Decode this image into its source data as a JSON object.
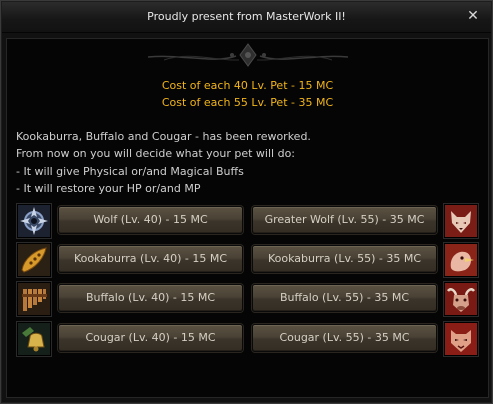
{
  "window": {
    "title": "Proudly present from MasterWork II!",
    "close_label": "✕"
  },
  "costs": {
    "line1": "Cost of each 40 Lv. Pet - 15 MC",
    "line2": "Cost of each 55 Lv. Pet - 35 MC"
  },
  "description": [
    "Kookaburra, Buffalo and Cougar - has been reworked.",
    "From now on you will decide what your pet will do:",
    "- It will give Physical or/and Magical Buffs",
    "- It will restore your HP or/and MP"
  ],
  "pets": [
    {
      "left_icon": "wolf-collar-icon",
      "right_icon": "greater-wolf-portrait-icon",
      "lv40_label": "Wolf (Lv. 40) - 15 MC",
      "lv55_label": "Greater Wolf (Lv. 55) - 35 MC"
    },
    {
      "left_icon": "ocarina-icon",
      "right_icon": "kookaburra-portrait-icon",
      "lv40_label": "Kookaburra (Lv. 40) - 15 MC",
      "lv55_label": "Kookaburra (Lv. 55) - 35 MC"
    },
    {
      "left_icon": "pan-flute-icon",
      "right_icon": "buffalo-portrait-icon",
      "lv40_label": "Buffalo (Lv. 40) - 15 MC",
      "lv55_label": "Buffalo (Lv. 55) - 35 MC"
    },
    {
      "left_icon": "bell-icon",
      "right_icon": "cougar-portrait-icon",
      "lv40_label": "Cougar (Lv. 40) - 15 MC",
      "lv55_label": "Cougar (Lv. 55) - 35 MC"
    }
  ],
  "colors": {
    "cost_text": "#f2b51a",
    "button_face": "#4a4235",
    "panel_bg": "#050505"
  }
}
